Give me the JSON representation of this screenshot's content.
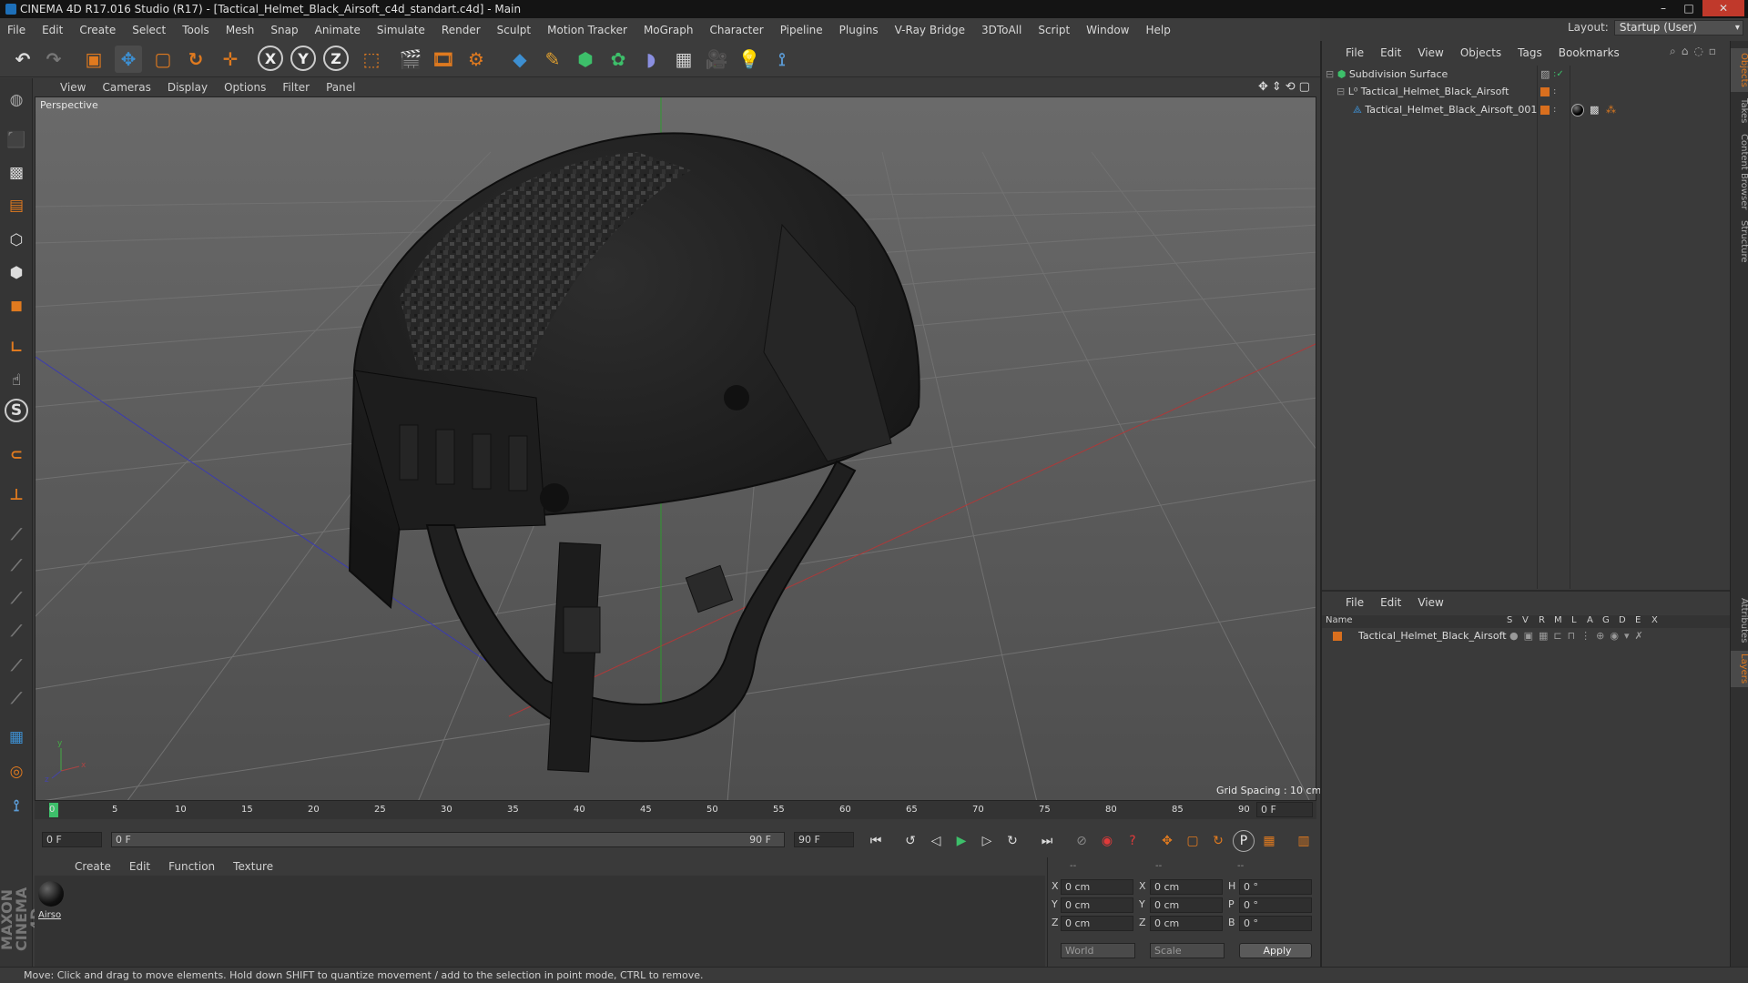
{
  "window": {
    "title": "CINEMA 4D R17.016 Studio (R17) - [Tactical_Helmet_Black_Airsoft_c4d_standart.c4d] - Main",
    "buttons": [
      "–",
      "□",
      "✕"
    ]
  },
  "menubar": [
    "File",
    "Edit",
    "Create",
    "Select",
    "Tools",
    "Mesh",
    "Snap",
    "Animate",
    "Simulate",
    "Render",
    "Sculpt",
    "Motion Tracker",
    "MoGraph",
    "Character",
    "Pipeline",
    "Plugins",
    "V-Ray Bridge",
    "3DToAll",
    "Script",
    "Window",
    "Help"
  ],
  "layout": {
    "label": "Layout:",
    "value": "Startup (User)"
  },
  "viewport": {
    "menu": [
      "View",
      "Cameras",
      "Display",
      "Options",
      "Filter",
      "Panel"
    ],
    "camera_label": "Perspective",
    "grid_spacing": "Grid Spacing : 10 cm"
  },
  "timeline": {
    "ticks": [
      "0",
      "5",
      "10",
      "15",
      "20",
      "25",
      "30",
      "35",
      "40",
      "45",
      "50",
      "55",
      "60",
      "65",
      "70",
      "75",
      "80",
      "85",
      "90"
    ],
    "current_frame": "0 F",
    "start_field": "0 F",
    "range_start": "0 F",
    "range_end": "90 F",
    "end_field": "90 F"
  },
  "material_manager": {
    "menu": [
      "Create",
      "Edit",
      "Function",
      "Texture"
    ],
    "materials": [
      {
        "name": "Airso"
      }
    ]
  },
  "coordinates": {
    "headers": [
      "--",
      "--",
      "--"
    ],
    "rows": [
      {
        "axis": "X",
        "pos": "0 cm",
        "axis2": "X",
        "size": "0 cm",
        "rot_label": "H",
        "rot": "0 °"
      },
      {
        "axis": "Y",
        "pos": "0 cm",
        "axis2": "Y",
        "size": "0 cm",
        "rot_label": "P",
        "rot": "0 °"
      },
      {
        "axis": "Z",
        "pos": "0 cm",
        "axis2": "Z",
        "size": "0 cm",
        "rot_label": "B",
        "rot": "0 °"
      }
    ],
    "mode": "World",
    "scale_mode": "Scale",
    "apply": "Apply"
  },
  "object_manager": {
    "menu": [
      "File",
      "Edit",
      "View",
      "Objects",
      "Tags",
      "Bookmarks"
    ],
    "objects": [
      {
        "name": "Subdivision Surface"
      },
      {
        "name": "Tactical_Helmet_Black_Airsoft"
      },
      {
        "name": "Tactical_Helmet_Black_Airsoft_001"
      }
    ]
  },
  "layer_manager": {
    "menu": [
      "File",
      "Edit",
      "View"
    ],
    "columns": [
      "Name",
      "S",
      "V",
      "R",
      "M",
      "L",
      "A",
      "G",
      "D",
      "E",
      "X"
    ],
    "layers": [
      {
        "name": "Tactical_Helmet_Black_Airsoft"
      }
    ]
  },
  "side_tabs": [
    "Objects",
    "Takes",
    "Content Browser",
    "Structure",
    "Attributes",
    "Layers"
  ],
  "statusbar": "Move: Click and drag to move elements. Hold down SHIFT to quantize movement / add to the selection in point mode, CTRL to remove.",
  "logo": "MAXON CINEMA 4D",
  "colors": {
    "accent": "#3d8fd1",
    "orange": "#e07a1f",
    "object_orange": "#d96f1e"
  }
}
